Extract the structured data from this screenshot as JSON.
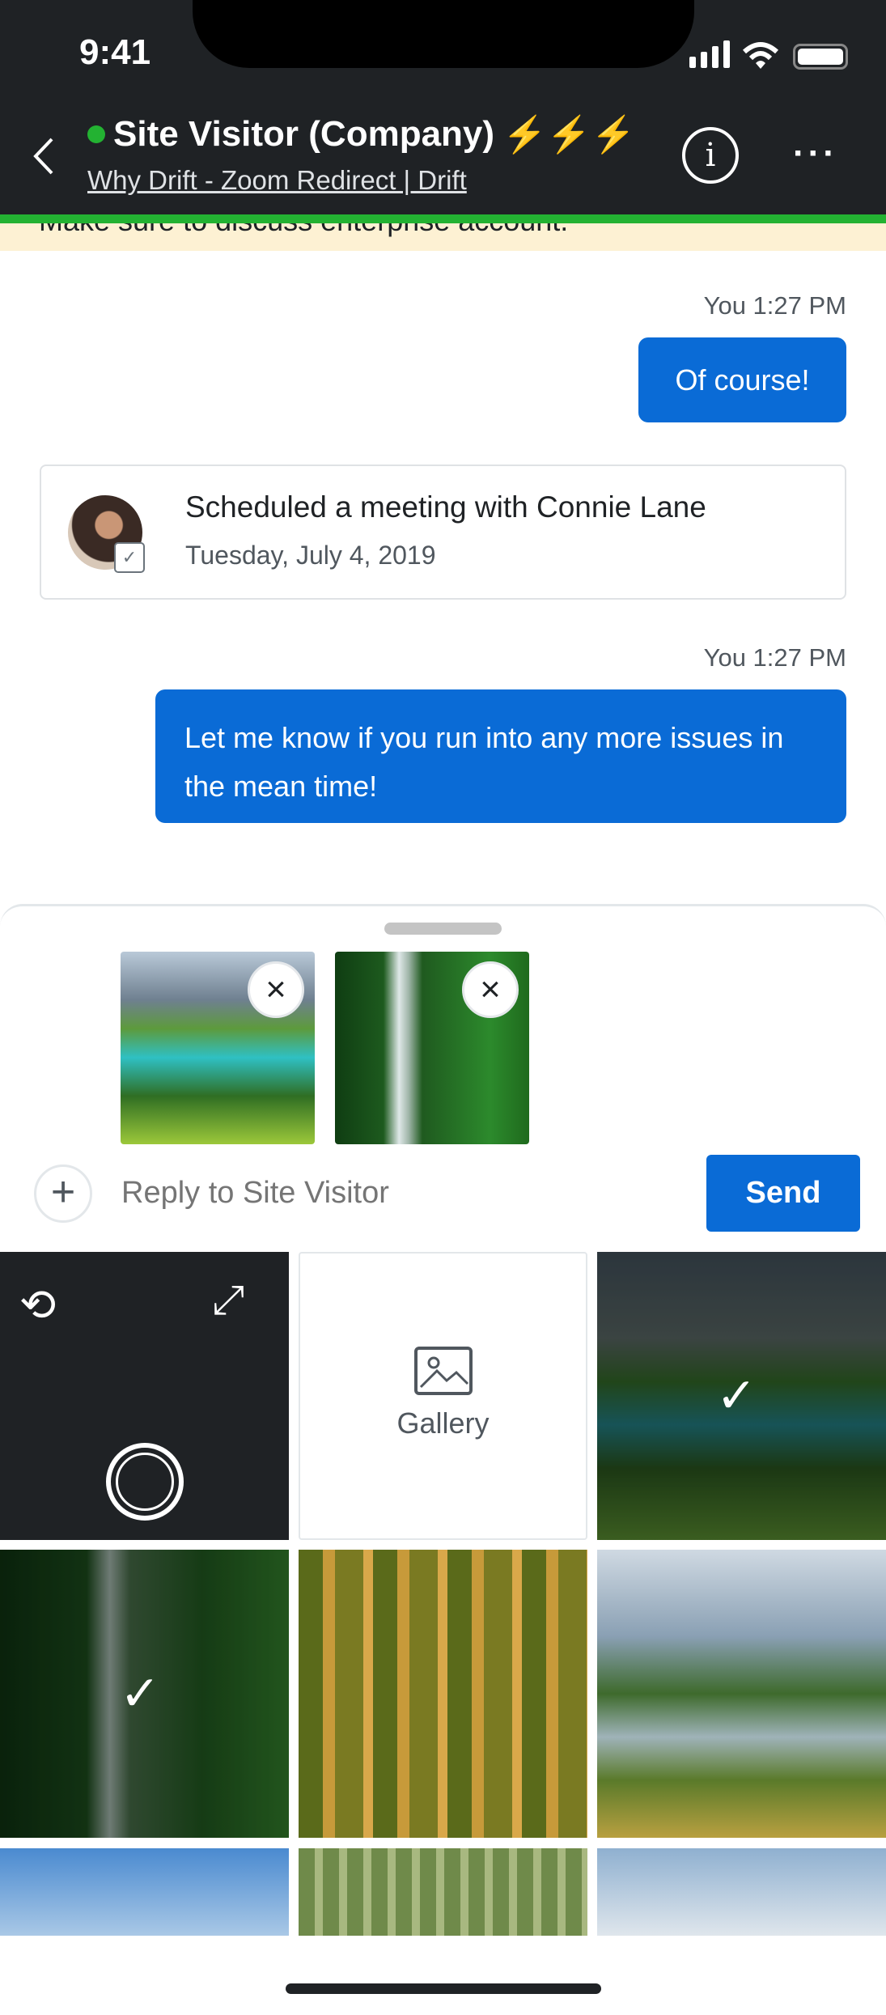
{
  "status_bar": {
    "time": "9:41"
  },
  "header": {
    "title": "Site Visitor (Company)",
    "emoji": "⚡⚡⚡",
    "subtitle": "Why Drift - Zoom Redirect | Drift",
    "online_color": "#23b232"
  },
  "banner": {
    "text": "Make sure to discuss enterprise account."
  },
  "messages": [
    {
      "meta": "You 1:27 PM",
      "text": "Of course!"
    },
    {
      "type": "meeting",
      "title": "Scheduled a meeting with Connie Lane",
      "date": "Tuesday, July 4, 2019"
    },
    {
      "meta": "You 1:27 PM",
      "text": "Let me know if you run into any more issues in the mean time!"
    }
  ],
  "composer": {
    "placeholder": "Reply to Site Visitor",
    "send_label": "Send",
    "attachments": [
      "lake-mountain",
      "waterfall"
    ]
  },
  "picker": {
    "gallery_label": "Gallery"
  },
  "colors": {
    "accent": "#0a6bd6",
    "header": "#1f2225"
  }
}
